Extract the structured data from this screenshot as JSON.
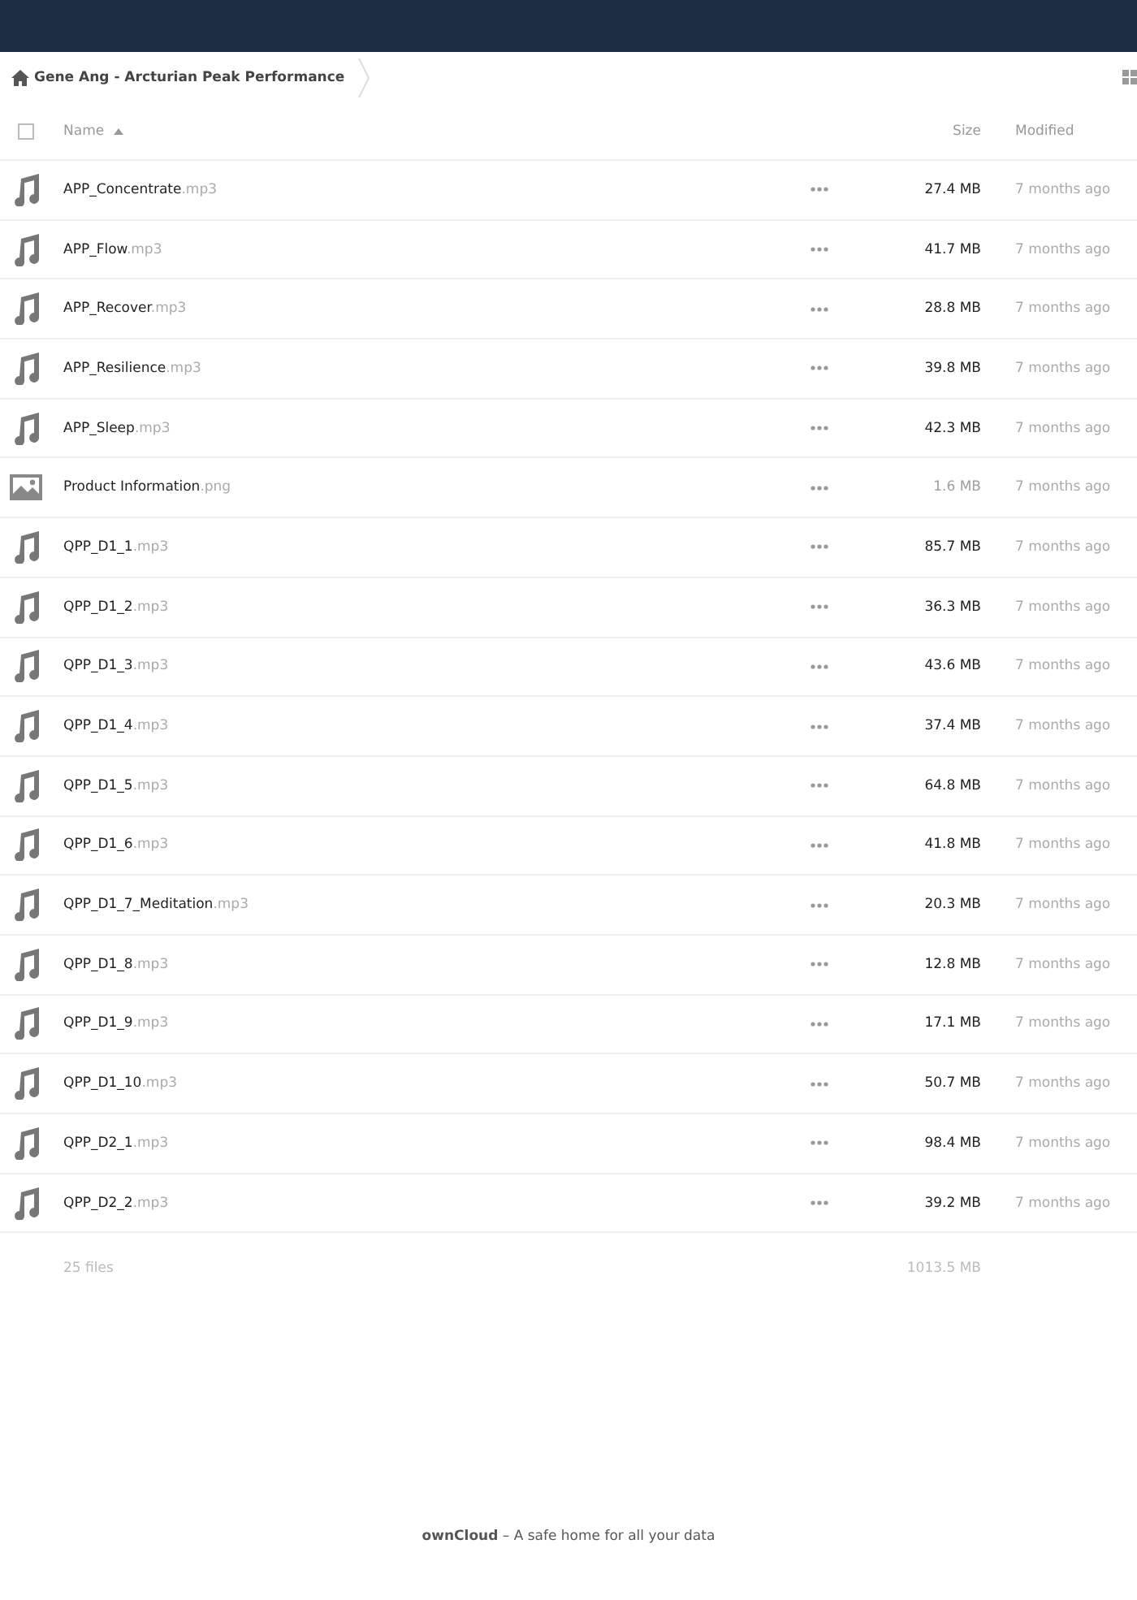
{
  "breadcrumb": {
    "label": "Gene Ang - Arcturian Peak Performance"
  },
  "table": {
    "select_all": {
      "checked": false
    },
    "columns": [
      {
        "label": "Name",
        "sorted": true
      },
      {
        "label": "Size",
        "sorted": false
      },
      {
        "label": "Modified",
        "sorted": false
      }
    ],
    "rows": [
      {
        "kind": "audio",
        "name": "APP_Concentrate",
        "ext": ".mp3",
        "size": "27.4 MB",
        "color": "#222222",
        "modified": "7 months ago"
      },
      {
        "kind": "audio",
        "name": "APP_Flow",
        "ext": ".mp3",
        "size": "41.7 MB",
        "color": "#222222",
        "modified": "7 months ago"
      },
      {
        "kind": "audio",
        "name": "APP_Recover",
        "ext": ".mp3",
        "size": "28.8 MB",
        "color": "#222222",
        "modified": "7 months ago"
      },
      {
        "kind": "audio",
        "name": "APP_Resilience",
        "ext": ".mp3",
        "size": "39.8 MB",
        "color": "#222222",
        "modified": "7 months ago"
      },
      {
        "kind": "audio",
        "name": "APP_Sleep",
        "ext": ".mp3",
        "size": "42.3 MB",
        "color": "#222222",
        "modified": "7 months ago"
      },
      {
        "kind": "image",
        "name": "Product Information",
        "ext": ".png",
        "size": "1.6 MB",
        "color": "#a0a0a0",
        "modified": "7 months ago"
      },
      {
        "kind": "audio",
        "name": "QPP_D1_1",
        "ext": ".mp3",
        "size": "85.7 MB",
        "color": "#222222",
        "modified": "7 months ago"
      },
      {
        "kind": "audio",
        "name": "QPP_D1_2",
        "ext": ".mp3",
        "size": "36.3 MB",
        "color": "#222222",
        "modified": "7 months ago"
      },
      {
        "kind": "audio",
        "name": "QPP_D1_3",
        "ext": ".mp3",
        "size": "43.6 MB",
        "color": "#222222",
        "modified": "7 months ago"
      },
      {
        "kind": "audio",
        "name": "QPP_D1_4",
        "ext": ".mp3",
        "size": "37.4 MB",
        "color": "#222222",
        "modified": "7 months ago"
      },
      {
        "kind": "audio",
        "name": "QPP_D1_5",
        "ext": ".mp3",
        "size": "64.8 MB",
        "color": "#222222",
        "modified": "7 months ago"
      },
      {
        "kind": "audio",
        "name": "QPP_D1_6",
        "ext": ".mp3",
        "size": "41.8 MB",
        "color": "#222222",
        "modified": "7 months ago"
      },
      {
        "kind": "audio",
        "name": "QPP_D1_7_Meditation",
        "ext": ".mp3",
        "size": "20.3 MB",
        "color": "#222222",
        "modified": "7 months ago"
      },
      {
        "kind": "audio",
        "name": "QPP_D1_8",
        "ext": ".mp3",
        "size": "12.8 MB",
        "color": "#222222",
        "modified": "7 months ago"
      },
      {
        "kind": "audio",
        "name": "QPP_D1_9",
        "ext": ".mp3",
        "size": "17.1 MB",
        "color": "#222222",
        "modified": "7 months ago"
      },
      {
        "kind": "audio",
        "name": "QPP_D1_10",
        "ext": ".mp3",
        "size": "50.7 MB",
        "color": "#222222",
        "modified": "7 months ago"
      },
      {
        "kind": "audio",
        "name": "QPP_D2_1",
        "ext": ".mp3",
        "size": "98.4 MB",
        "color": "#222222",
        "modified": "7 months ago"
      },
      {
        "kind": "audio",
        "name": "QPP_D2_2",
        "ext": ".mp3",
        "size": "39.2 MB",
        "color": "#222222",
        "modified": "7 months ago"
      }
    ],
    "summary": {
      "count": "25 files",
      "total": "1013.5 MB"
    }
  },
  "footer": {
    "brand": "ownCloud",
    "tagline": " – A safe home for all your data"
  }
}
